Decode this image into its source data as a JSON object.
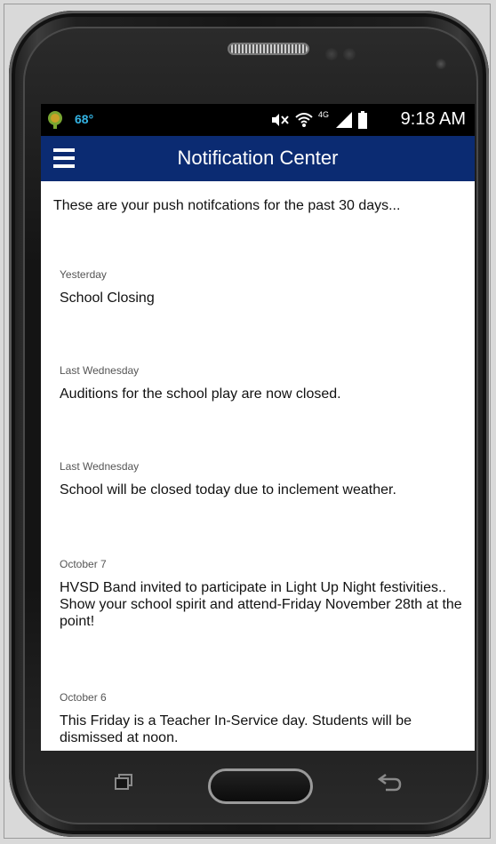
{
  "status_bar": {
    "temperature": "68°",
    "network_label": "4G",
    "time": "9:18 AM"
  },
  "app_bar": {
    "menu_icon": "hamburger-menu-icon",
    "title": "Notification Center"
  },
  "intro_text": "These are your push notifcations for the past 30 days...",
  "notifications": [
    {
      "date": "Yesterday",
      "text": "School Closing"
    },
    {
      "date": "Last Wednesday",
      "text": "Auditions for the school play are now closed."
    },
    {
      "date": "Last Wednesday",
      "text": "School will be closed today due to inclement weather."
    },
    {
      "date": "October 7",
      "text": "HVSD Band invited to participate in Light Up Night festivities.. Show your school spirit and attend-Friday November 28th at the point!"
    },
    {
      "date": "October 6",
      "text": "This Friday is a Teacher In-Service day. Students will be dismissed at noon."
    }
  ],
  "colors": {
    "app_bar": "#0b2b72",
    "status_bar": "#000000",
    "temperature": "#34b4e4"
  }
}
